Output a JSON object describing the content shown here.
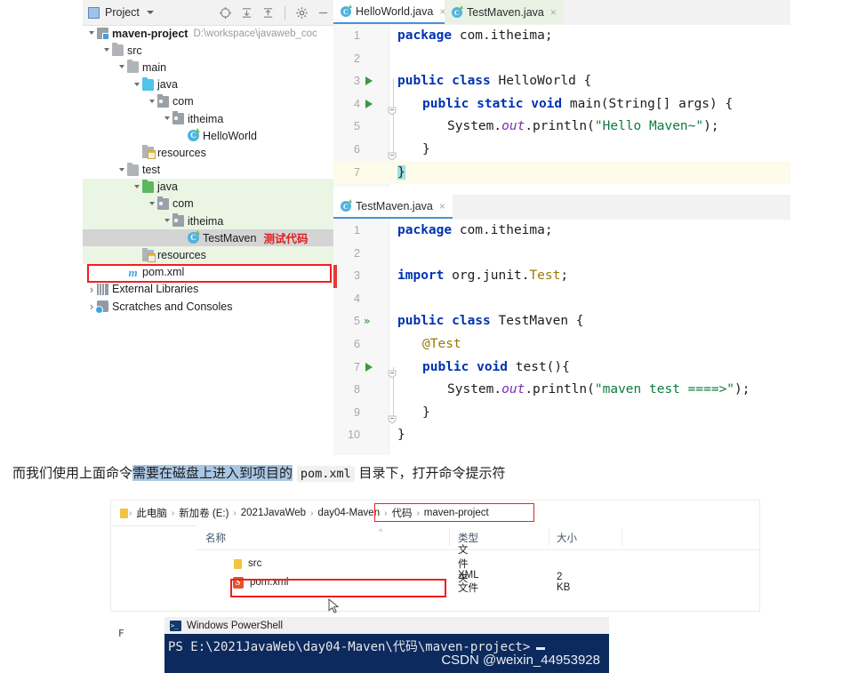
{
  "ide": {
    "project_panel": {
      "title": "Project",
      "tool_icons": [
        "locate-icon",
        "expand-all-icon",
        "collapse-all-icon",
        "gear-icon",
        "minimize-icon"
      ],
      "tree": [
        {
          "label": "maven-project",
          "path": "D:\\workspace\\javaweb_coc",
          "indent": 0,
          "arrow": "down",
          "icon": "module-icon",
          "bold": true,
          "band": "none"
        },
        {
          "label": "src",
          "indent": 1,
          "arrow": "down",
          "icon": "folder-icon",
          "band": "none"
        },
        {
          "label": "main",
          "indent": 2,
          "arrow": "down",
          "icon": "folder-icon",
          "band": "none"
        },
        {
          "label": "java",
          "indent": 3,
          "arrow": "down",
          "icon": "folder-blue-icon",
          "band": "none"
        },
        {
          "label": "com",
          "indent": 4,
          "arrow": "down",
          "icon": "package-icon",
          "band": "none"
        },
        {
          "label": "itheima",
          "indent": 5,
          "arrow": "down",
          "icon": "package-icon",
          "band": "none"
        },
        {
          "label": "HelloWorld",
          "indent": 6,
          "arrow": "none",
          "icon": "java-class-icon",
          "band": "none"
        },
        {
          "label": "resources",
          "indent": 3,
          "arrow": "none",
          "icon": "resources-icon",
          "band": "none"
        },
        {
          "label": "test",
          "indent": 2,
          "arrow": "down",
          "icon": "folder-icon",
          "band": "none"
        },
        {
          "label": "java",
          "indent": 3,
          "arrow": "down",
          "icon": "folder-green-icon",
          "band": "green"
        },
        {
          "label": "com",
          "indent": 4,
          "arrow": "down",
          "icon": "package-icon",
          "band": "green"
        },
        {
          "label": "itheima",
          "indent": 5,
          "arrow": "down",
          "icon": "package-icon",
          "band": "green"
        },
        {
          "label": "TestMaven",
          "indent": 6,
          "arrow": "none",
          "icon": "java-class-icon",
          "band": "selected",
          "tag": "测试代码"
        },
        {
          "label": "resources",
          "indent": 3,
          "arrow": "none",
          "icon": "resources-icon",
          "band": "green"
        },
        {
          "label": "pom.xml",
          "indent": 2,
          "arrow": "none",
          "icon": "maven-m-icon",
          "band": "none"
        },
        {
          "label": "External Libraries",
          "indent": 0,
          "arrow": "right",
          "icon": "libraries-icon",
          "band": "none"
        },
        {
          "label": "Scratches and Consoles",
          "indent": 0,
          "arrow": "right",
          "icon": "scratches-icon",
          "band": "none"
        }
      ]
    },
    "tabs_top": [
      {
        "label": "HelloWorld.java",
        "active": true
      },
      {
        "label": "TestMaven.java",
        "active": false
      }
    ],
    "tabs_bottom": [
      {
        "label": "TestMaven.java",
        "active": true
      }
    ],
    "editor_top": {
      "file": "HelloWorld.java",
      "lines": [
        {
          "n": "1",
          "segments": [
            {
              "t": "package",
              "c": "k"
            },
            {
              "t": " com.itheima;",
              "c": "n"
            }
          ],
          "indent": 0
        },
        {
          "n": "2",
          "segments": [],
          "indent": 0
        },
        {
          "n": "3",
          "segments": [
            {
              "t": "public class ",
              "c": "k"
            },
            {
              "t": "HelloWorld ",
              "c": "n"
            },
            {
              "t": "{",
              "c": "n"
            }
          ],
          "indent": 0,
          "gutter": "run"
        },
        {
          "n": "4",
          "segments": [
            {
              "t": "public static void ",
              "c": "k"
            },
            {
              "t": "main",
              "c": "n"
            },
            {
              "t": "(",
              "c": "n"
            },
            {
              "t": "String",
              "c": "n"
            },
            {
              "t": "[] args) {",
              "c": "n"
            }
          ],
          "indent": 1,
          "gutter": "run",
          "fold": true
        },
        {
          "n": "5",
          "segments": [
            {
              "t": "System.",
              "c": "n"
            },
            {
              "t": "out",
              "c": "f"
            },
            {
              "t": ".println(",
              "c": "n"
            },
            {
              "t": "\"Hello Maven~\"",
              "c": "s"
            },
            {
              "t": ");",
              "c": "n"
            }
          ],
          "indent": 2
        },
        {
          "n": "6",
          "segments": [
            {
              "t": "}",
              "c": "n"
            }
          ],
          "indent": 1,
          "fold": true
        },
        {
          "n": "7",
          "segments": [
            {
              "t": "}",
              "c": "brc"
            }
          ],
          "indent": 0,
          "highlight": true
        }
      ]
    },
    "editor_bottom": {
      "file": "TestMaven.java",
      "lines": [
        {
          "n": "1",
          "segments": [
            {
              "t": "package",
              "c": "k"
            },
            {
              "t": " com.itheima;",
              "c": "n"
            }
          ],
          "indent": 0
        },
        {
          "n": "2",
          "segments": [],
          "indent": 0
        },
        {
          "n": "3",
          "segments": [
            {
              "t": "import",
              "c": "k"
            },
            {
              "t": " org.junit.",
              "c": "n"
            },
            {
              "t": "Test",
              "c": "t"
            },
            {
              "t": ";",
              "c": "n"
            }
          ],
          "indent": 0,
          "error": true
        },
        {
          "n": "4",
          "segments": [],
          "indent": 0
        },
        {
          "n": "5",
          "segments": [
            {
              "t": "public class ",
              "c": "k"
            },
            {
              "t": "TestMaven {",
              "c": "n"
            }
          ],
          "indent": 0,
          "gutter": "runall"
        },
        {
          "n": "6",
          "segments": [
            {
              "t": "@Test",
              "c": "a"
            }
          ],
          "indent": 1
        },
        {
          "n": "7",
          "segments": [
            {
              "t": "public void ",
              "c": "k"
            },
            {
              "t": "test(){",
              "c": "n"
            }
          ],
          "indent": 1,
          "gutter": "run",
          "fold": true
        },
        {
          "n": "8",
          "segments": [
            {
              "t": "System.",
              "c": "n"
            },
            {
              "t": "out",
              "c": "f"
            },
            {
              "t": ".println(",
              "c": "n"
            },
            {
              "t": "\"maven test ====>\"",
              "c": "s"
            },
            {
              "t": ");",
              "c": "n"
            }
          ],
          "indent": 2
        },
        {
          "n": "9",
          "segments": [
            {
              "t": "}",
              "c": "n"
            }
          ],
          "indent": 1,
          "fold": true
        },
        {
          "n": "10",
          "segments": [
            {
              "t": "}",
              "c": "n"
            }
          ],
          "indent": 0
        }
      ]
    }
  },
  "caption": {
    "part1": "而我们使用上面命令",
    "highlight": "需要在磁盘上进入到项目的",
    "code": "pom.xml",
    "part2": "目录下，打开命令提示符"
  },
  "explorer": {
    "breadcrumb": [
      "此电脑",
      "新加卷 (E:)",
      "2021JavaWeb",
      "day04-Maven",
      "代码",
      "maven-project"
    ],
    "columns": [
      "名称",
      "类型",
      "大小"
    ],
    "rows": [
      {
        "name": "src",
        "type": "文件夹",
        "size": "",
        "icon": "folder-icon"
      },
      {
        "name": "pom.xml",
        "type": "XML 文件",
        "size": "2 KB",
        "icon": "xml-file-icon"
      }
    ]
  },
  "powershell": {
    "title": "Windows PowerShell",
    "prompt": "PS E:\\2021JavaWeb\\day04-Maven\\代码\\maven-project>"
  },
  "watermark": "CSDN @weixin_44953928",
  "stray_glyph": "F"
}
